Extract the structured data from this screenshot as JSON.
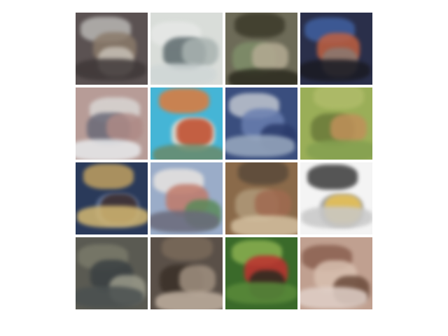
{
  "figure": {
    "background": "#ffffff",
    "rows": 4,
    "cols": 4,
    "content_kind": "generated low-resolution sample images",
    "tiles": [
      {
        "id": "r1c1",
        "colors": [
          "#5b5252",
          "#b8b6b3",
          "#8a7a6a",
          "#c7c0b6",
          "#3f3838"
        ]
      },
      {
        "id": "r1c2",
        "colors": [
          "#d9ddd9",
          "#e6e8e6",
          "#5d6a6d",
          "#a9b3b1",
          "#cfd6d6"
        ]
      },
      {
        "id": "r1c3",
        "colors": [
          "#6d6b58",
          "#3c3a2a",
          "#7f8f6a",
          "#b4ab93",
          "#2b2a1e"
        ]
      },
      {
        "id": "r1c4",
        "colors": [
          "#2a2f4a",
          "#4060a0",
          "#c06040",
          "#8a7a72",
          "#1a1a22"
        ]
      },
      {
        "id": "r2c1",
        "colors": [
          "#b79c97",
          "#d9d6d4",
          "#6a6a78",
          "#ae8a86",
          "#e8eaec"
        ]
      },
      {
        "id": "r2c2",
        "colors": [
          "#45b5d6",
          "#e07a3a",
          "#f0e0d0",
          "#c04a2a",
          "#6a8a6a"
        ]
      },
      {
        "id": "r2c3",
        "colors": [
          "#3a4e7e",
          "#c0c6d0",
          "#6a7fb0",
          "#2a3a6a",
          "#9aaac0"
        ]
      },
      {
        "id": "r2c4",
        "colors": [
          "#9aae58",
          "#b0bc6a",
          "#6a7a3a",
          "#c0905a",
          "#84a050"
        ]
      },
      {
        "id": "r3c1",
        "colors": [
          "#2a3a5a",
          "#c0a060",
          "#6a7a9a",
          "#3a2a2a",
          "#d4b872"
        ]
      },
      {
        "id": "r3c2",
        "colors": [
          "#9aacc8",
          "#e8e4e0",
          "#c07a6a",
          "#5a8a5a",
          "#6a6a7a"
        ]
      },
      {
        "id": "r3c3",
        "colors": [
          "#8a6a4a",
          "#5a4a3a",
          "#b09a7a",
          "#a06a50",
          "#d4c0a0"
        ]
      },
      {
        "id": "r3c4",
        "colors": [
          "#f4f4f4",
          "#3a3a3a",
          "#9a9a9a",
          "#e8c050",
          "#c8c8c8"
        ]
      },
      {
        "id": "r4c1",
        "colors": [
          "#5a5a52",
          "#7a7a6a",
          "#3a4042",
          "#9a9a8a",
          "#4a5050"
        ]
      },
      {
        "id": "r4c2",
        "colors": [
          "#5a5048",
          "#7a6a5a",
          "#3a3028",
          "#a09080",
          "#c0b0a0"
        ]
      },
      {
        "id": "r4c3",
        "colors": [
          "#3a6a2a",
          "#8ab050",
          "#c03030",
          "#2a2a20",
          "#5a8a3a"
        ]
      },
      {
        "id": "r4c4",
        "colors": [
          "#c0a090",
          "#8a6050",
          "#d8c0b0",
          "#6a4a3a",
          "#e0d0c8"
        ]
      }
    ]
  }
}
